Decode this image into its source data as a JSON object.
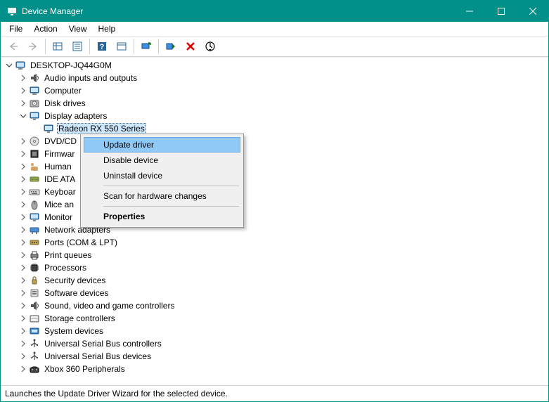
{
  "window": {
    "title": "Device Manager"
  },
  "menubar": {
    "items": [
      "File",
      "Action",
      "View",
      "Help"
    ]
  },
  "tree": {
    "root": {
      "label": "DESKTOP-JQ44G0M",
      "expanded": true,
      "kind": "computer"
    },
    "categories": [
      {
        "label": "Audio inputs and outputs",
        "expanded": false,
        "kind": "audio"
      },
      {
        "label": "Computer",
        "expanded": false,
        "kind": "computer-cat"
      },
      {
        "label": "Disk drives",
        "expanded": false,
        "kind": "disk"
      },
      {
        "label": "Display adapters",
        "expanded": true,
        "kind": "display",
        "children": [
          {
            "label": "Radeon RX 550 Series",
            "kind": "display",
            "selected": true
          }
        ]
      },
      {
        "label": "DVD/CD",
        "full_label": "DVD/CD-ROM drives",
        "expanded": false,
        "kind": "optical"
      },
      {
        "label": "Firmwar",
        "full_label": "Firmware",
        "expanded": false,
        "kind": "firmware"
      },
      {
        "label": "Human",
        "full_label": "Human Interface Devices",
        "expanded": false,
        "kind": "hid"
      },
      {
        "label": "IDE ATA",
        "full_label": "IDE ATA/ATAPI controllers",
        "expanded": false,
        "kind": "ide"
      },
      {
        "label": "Keyboar",
        "full_label": "Keyboards",
        "expanded": false,
        "kind": "keyboard"
      },
      {
        "label": "Mice an",
        "full_label": "Mice and other pointing devices",
        "expanded": false,
        "kind": "mouse"
      },
      {
        "label": "Monitor",
        "full_label": "Monitors",
        "expanded": false,
        "kind": "monitor"
      },
      {
        "label": "Network adapters",
        "expanded": false,
        "kind": "network"
      },
      {
        "label": "Ports (COM & LPT)",
        "expanded": false,
        "kind": "ports"
      },
      {
        "label": "Print queues",
        "expanded": false,
        "kind": "printer"
      },
      {
        "label": "Processors",
        "expanded": false,
        "kind": "cpu"
      },
      {
        "label": "Security devices",
        "expanded": false,
        "kind": "security"
      },
      {
        "label": "Software devices",
        "expanded": false,
        "kind": "software"
      },
      {
        "label": "Sound, video and game controllers",
        "expanded": false,
        "kind": "sound"
      },
      {
        "label": "Storage controllers",
        "expanded": false,
        "kind": "storage"
      },
      {
        "label": "System devices",
        "expanded": false,
        "kind": "system"
      },
      {
        "label": "Universal Serial Bus controllers",
        "expanded": false,
        "kind": "usb"
      },
      {
        "label": "Universal Serial Bus devices",
        "expanded": false,
        "kind": "usb"
      },
      {
        "label": "Xbox 360 Peripherals",
        "expanded": false,
        "kind": "xbox"
      }
    ]
  },
  "context_menu": {
    "items": [
      {
        "label": "Update driver",
        "highlight": true
      },
      {
        "label": "Disable device"
      },
      {
        "label": "Uninstall device"
      },
      {
        "sep": true
      },
      {
        "label": "Scan for hardware changes"
      },
      {
        "sep": true
      },
      {
        "label": "Properties",
        "bold": true
      }
    ]
  },
  "statusbar": {
    "text": "Launches the Update Driver Wizard for the selected device."
  }
}
